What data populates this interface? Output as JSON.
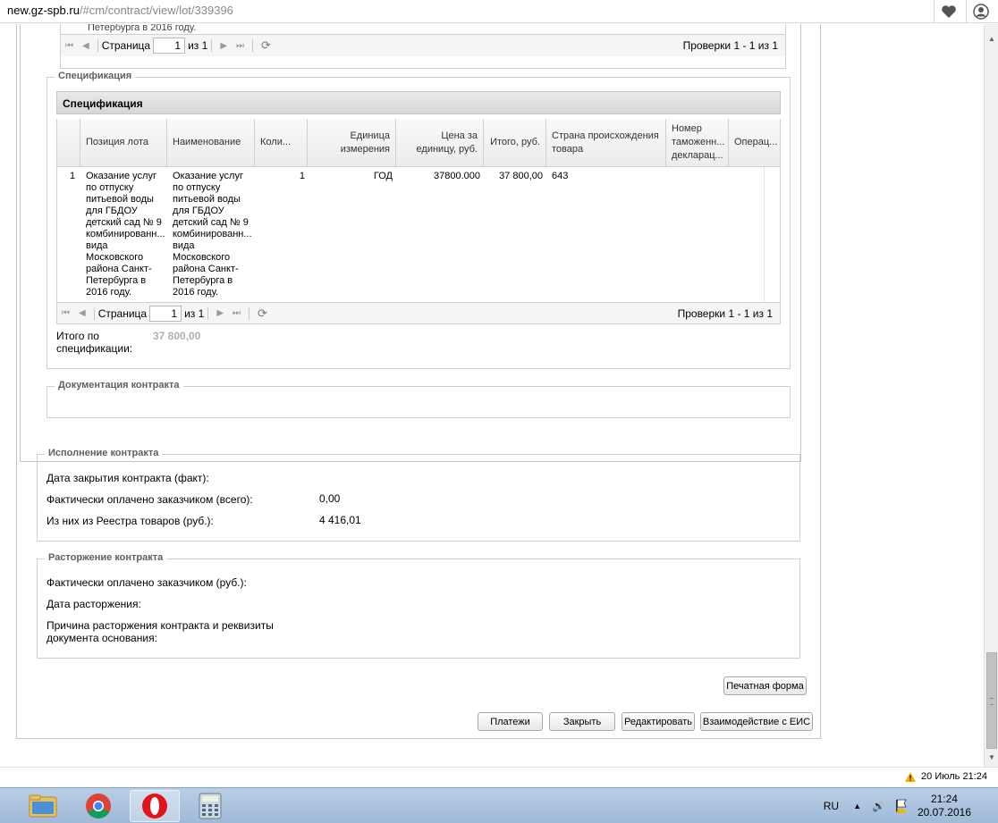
{
  "browser": {
    "url_domain": "new.gz-spb.ru",
    "url_path": "/#cm/contract/view/lot/339396"
  },
  "prev_grid": {
    "row_text": "Петербурга в 2016 году.",
    "pager": {
      "page_label": "Страница",
      "page_value": "1",
      "of_label": "из 1",
      "summary": "Проверки 1 - 1 из 1"
    }
  },
  "spec_section": {
    "legend": "Спецификация",
    "grid_title": "Спецификация",
    "columns": [
      "Позиция лота",
      "Наименование",
      "Коли...",
      "Единица измерения",
      "Цена за единицу, руб.",
      "Итого, руб.",
      "Страна происхождения товара",
      "Номер таможенн... декларац...",
      "Операц..."
    ],
    "row": {
      "num": "1",
      "position": "Оказание услуг по отпуску питьевой воды для ГБДОУ детский сад № 9 комбинированн... вида Московского района Санкт-Петербурга в 2016 году.",
      "name": "Оказание услуг по отпуску питьевой воды для ГБДОУ детский сад № 9 комбинированн... вида Московского района Санкт-Петербурга в 2016 году.",
      "qty": "1",
      "unit": "ГОД",
      "price": "37800.000",
      "total": "37 800,00",
      "country": "643"
    },
    "pager": {
      "page_label": "Страница",
      "page_value": "1",
      "of_label": "из 1",
      "summary": "Проверки 1 - 1 из 1"
    },
    "total_label": "Итого по спецификации:",
    "total_value": "37 800,00"
  },
  "docs_section": {
    "legend": "Документация контракта"
  },
  "execution_section": {
    "legend": "Исполнение контракта",
    "close_date_label": "Дата закрытия контракта (факт):",
    "paid_label": "Фактически оплачено заказчиком (всего):",
    "paid_value": "0,00",
    "registry_label": "Из них из Реестра товаров (руб.):",
    "registry_value": "4 416,01"
  },
  "termination_section": {
    "legend": "Расторжение контракта",
    "paid_label": "Фактически оплачено заказчиком (руб.):",
    "date_label": "Дата расторжения:",
    "reason_label": "Причина расторжения контракта и реквизиты документа основания:"
  },
  "buttons": {
    "print": "Печатная форма",
    "payments": "Платежи",
    "close": "Закрыть",
    "edit": "Редактировать",
    "eis": "Взаимодействие с ЕИС"
  },
  "status": {
    "notification": "20 Июль 21:24"
  },
  "taskbar": {
    "lang": "RU",
    "time": "21:24",
    "date": "20.07.2016"
  },
  "colors": {
    "accent_grey": "#606060",
    "taskbar": "#a9c2df"
  }
}
